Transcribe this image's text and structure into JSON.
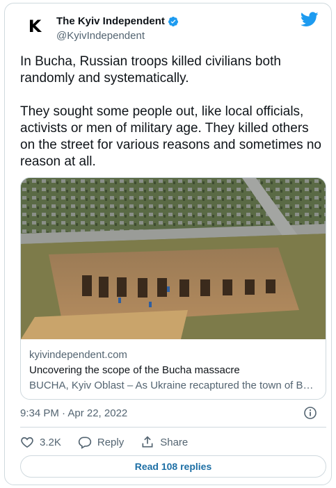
{
  "tweet": {
    "author": {
      "avatar_letter": "K",
      "name": "The Kyiv Independent",
      "handle": "@KyivIndependent"
    },
    "text": "In Bucha, Russian troops killed civilians both randomly and systematically.\n\nThey sought some people out, like local officials, activists or men of military age. They killed others on the street for various reasons and sometimes no reason at all.",
    "link_card": {
      "domain": "kyivindependent.com",
      "title": "Uncovering the scope of the Bucha massacre",
      "description": "BUCHA, Kyiv Oblast – As Ukraine recaptured the town of Bucha"
    },
    "timestamp": "9:34 PM · Apr 22, 2022",
    "actions": {
      "like_count": "3.2K",
      "reply_label": "Reply",
      "share_label": "Share"
    },
    "read_replies_label": "Read 108 replies"
  },
  "colors": {
    "brand_blue": "#1d9bf0",
    "text_primary": "#0f1419",
    "text_secondary": "#536471",
    "border": "#cfd9de"
  },
  "icons": [
    "verified-badge-icon",
    "twitter-bird-icon",
    "info-icon",
    "heart-icon",
    "reply-bubble-icon",
    "share-icon"
  ]
}
